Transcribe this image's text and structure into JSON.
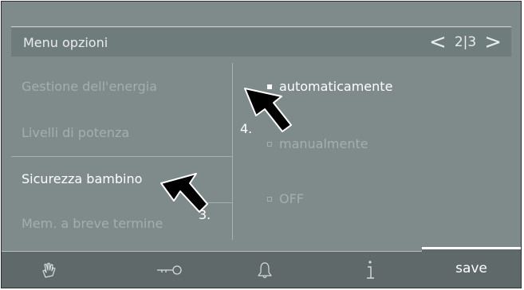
{
  "header": {
    "title": "Menu opzioni",
    "page": "2|3",
    "prev_icon": "chevron-left-icon",
    "next_icon": "chevron-right-icon"
  },
  "menu": {
    "items": [
      {
        "label": "Gestione dell'energia",
        "active": false
      },
      {
        "label": "Livelli di potenza",
        "active": false
      },
      {
        "label": "Sicurezza bambino",
        "active": true
      },
      {
        "label": "Mem. a breve termine",
        "active": false
      }
    ]
  },
  "options": [
    {
      "label": "automaticamente",
      "selected": true
    },
    {
      "label": "manualmente",
      "selected": false
    },
    {
      "label": "OFF",
      "selected": false
    }
  ],
  "callouts": {
    "step3": "3.",
    "step4": "4."
  },
  "footer": {
    "icons": [
      "hand-icon",
      "key-icon",
      "bell-icon",
      "info-icon"
    ],
    "save_label": "save"
  },
  "colors": {
    "background": "#7f8b8a",
    "header": "#6f7c7c",
    "footer": "#5f6969",
    "active_text": "#ffffff",
    "inactive_text": "#a3afae"
  }
}
